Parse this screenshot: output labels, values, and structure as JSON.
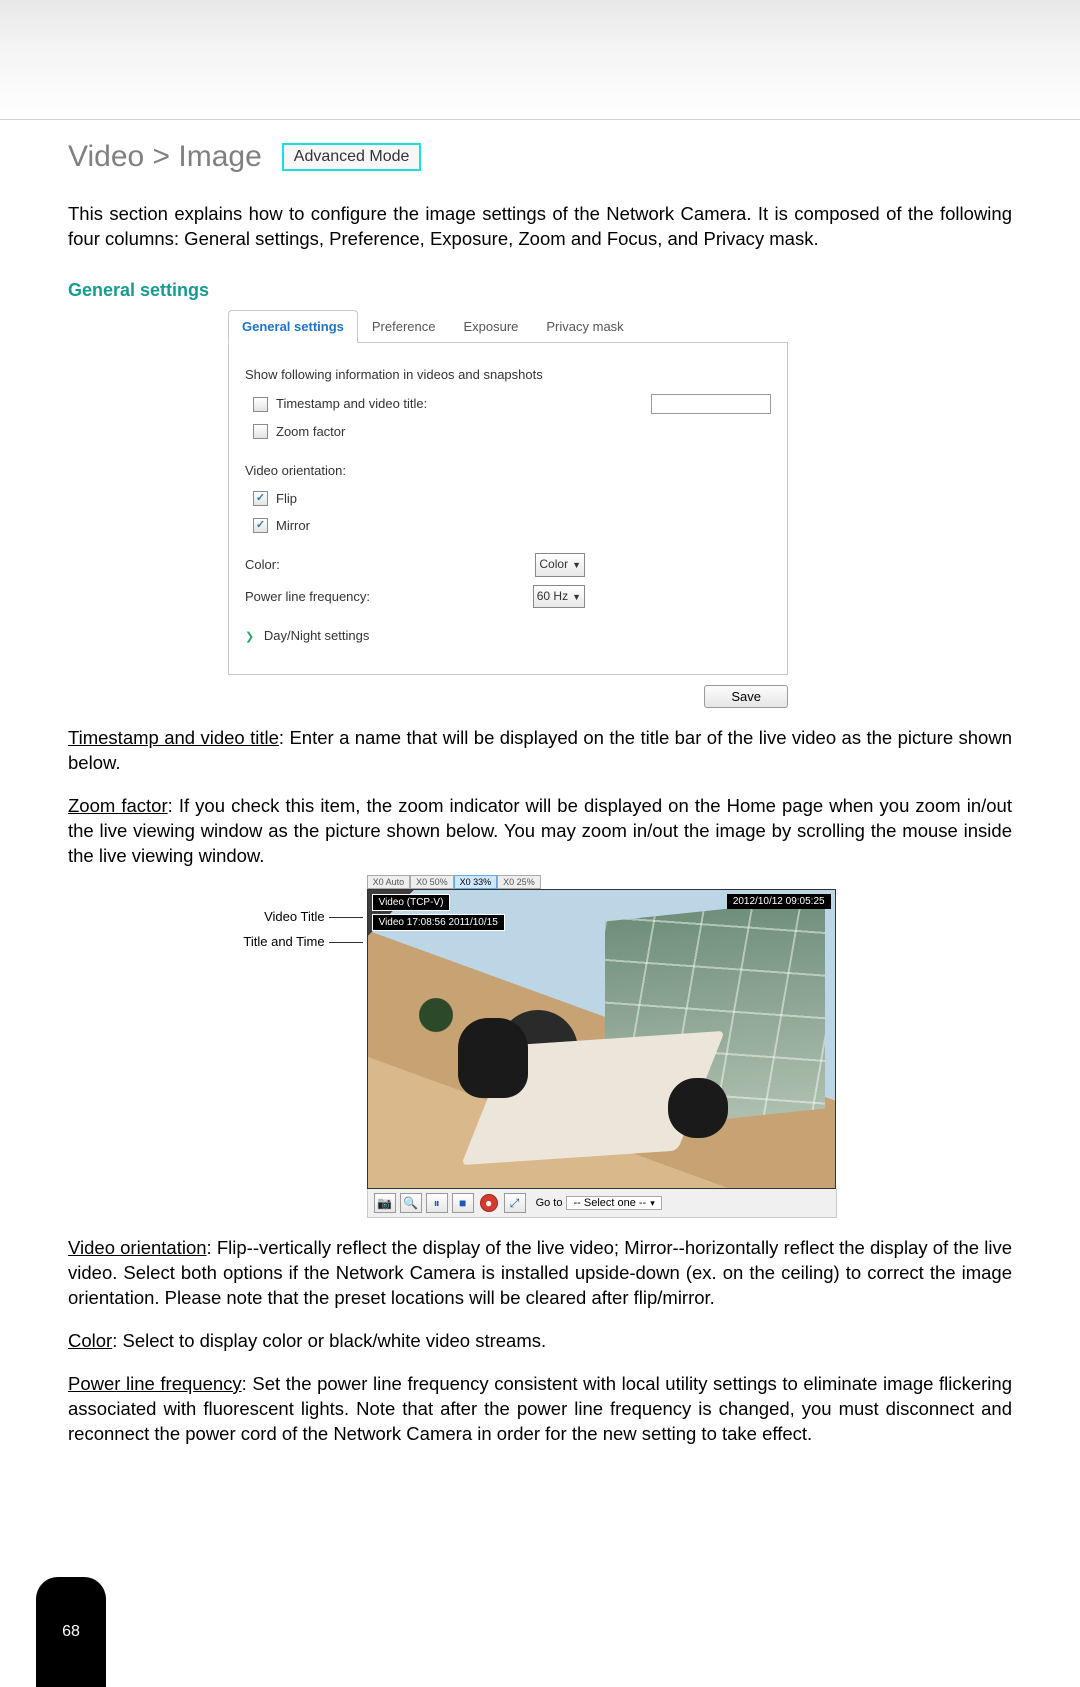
{
  "header": {
    "title": "Video > Image",
    "mode_badge": "Advanced Mode"
  },
  "intro": "This section explains how to configure the image settings of the Network Camera. It is composed of the following four columns: General settings, Preference, Exposure, Zoom and Focus, and Privacy mask.",
  "section_title": "General settings",
  "tabs": {
    "general": "General settings",
    "preference": "Preference",
    "exposure": "Exposure",
    "privacy": "Privacy mask"
  },
  "panel": {
    "show_info": "Show following information in videos and snapshots",
    "timestamp_label": "Timestamp and video title:",
    "timestamp_value": "",
    "zoom_factor": "Zoom factor",
    "orientation_label": "Video orientation:",
    "flip": "Flip",
    "mirror": "Mirror",
    "color_label": "Color:",
    "color_value": "Color",
    "plf_label": "Power line frequency:",
    "plf_value": "60 Hz",
    "daynight": "Day/Night settings",
    "save": "Save"
  },
  "para_timestamp_u": "Timestamp and video title",
  "para_timestamp": ": Enter a name that will be displayed on the title bar of the live video as the picture shown below.",
  "para_zoom_u": "Zoom factor",
  "para_zoom": ": If you check this item, the zoom indicator will be displayed on the Home page when you zoom in/out the live viewing window as the picture shown below. You may zoom in/out the image by scrolling the mouse inside the live viewing window.",
  "figure": {
    "label_video_title": "Video Title",
    "label_title_time": "Title and Time",
    "res_tabs": [
      "X0 Auto",
      "X0 50%",
      "X0 33%",
      "X0 25%"
    ],
    "overlay_tl": "Video (TCP-V)",
    "overlay_tl2": "Video 17:08:56 2011/10/15",
    "overlay_tr": "2012/10/12 09:05:25",
    "goto_label": "Go to",
    "goto_value": "-- Select one --"
  },
  "para_orientation_u": "Video orientation",
  "para_orientation": ": Flip--vertically reflect the display of the live video; Mirror--horizontally reflect the display of the live video. Select both options if the Network Camera is installed upside-down (ex. on the ceiling) to correct the image orientation. Please note that the preset locations will be cleared after flip/mirror.",
  "para_color_u": "Color",
  "para_color": ": Select to display color or black/white video streams.",
  "para_plf_u": "Power line frequency",
  "para_plf": ": Set the power line frequency consistent with local utility settings to eliminate image flickering associated with fluorescent lights. Note that after the power line frequency is changed, you must disconnect and reconnect the power cord of the Network Camera in order for the new setting to take effect.",
  "page_number": "68"
}
